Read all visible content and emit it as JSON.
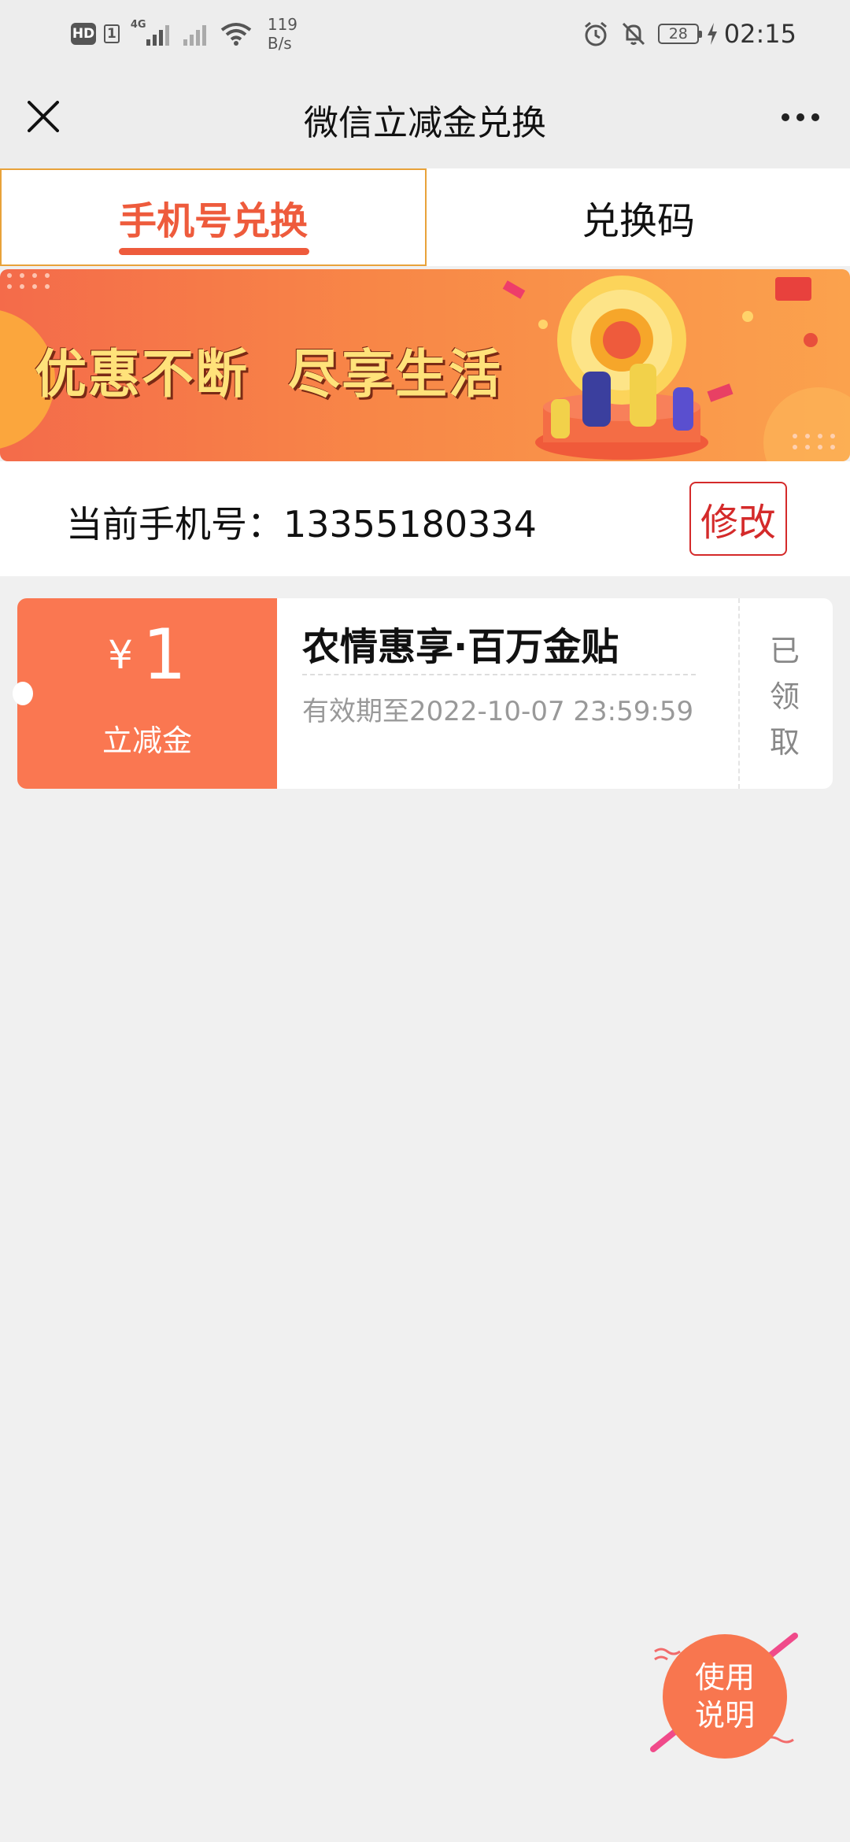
{
  "status_bar": {
    "hd_label": "HD",
    "sim_label": "1",
    "network_label": "4G",
    "speed_value": "119",
    "speed_unit": "B/s",
    "battery_level": "28",
    "time": "02:15"
  },
  "title_bar": {
    "title": "微信立减金兑换"
  },
  "tabs": [
    {
      "label": "手机号兑换",
      "active": true
    },
    {
      "label": "兑换码",
      "active": false
    }
  ],
  "banner": {
    "slogan": "优惠不断  尽享生活"
  },
  "phone": {
    "label": "当前手机号：13355180334",
    "edit_label": "修改"
  },
  "coupons": [
    {
      "currency_symbol": "¥",
      "amount": "1",
      "type_label": "立减金",
      "title": "农情惠享·百万金贴",
      "expiry": "有效期至2022-10-07 23:59:59",
      "status_chars": [
        "已",
        "领",
        "取"
      ]
    }
  ],
  "help_button": {
    "line1": "使用",
    "line2": "说明"
  },
  "colors": {
    "accent": "#ee5b3c",
    "coupon_left": "#fa7751",
    "edit_red": "#d42a2a",
    "tab_border": "#e8a23a",
    "background": "#f0f0f0"
  }
}
